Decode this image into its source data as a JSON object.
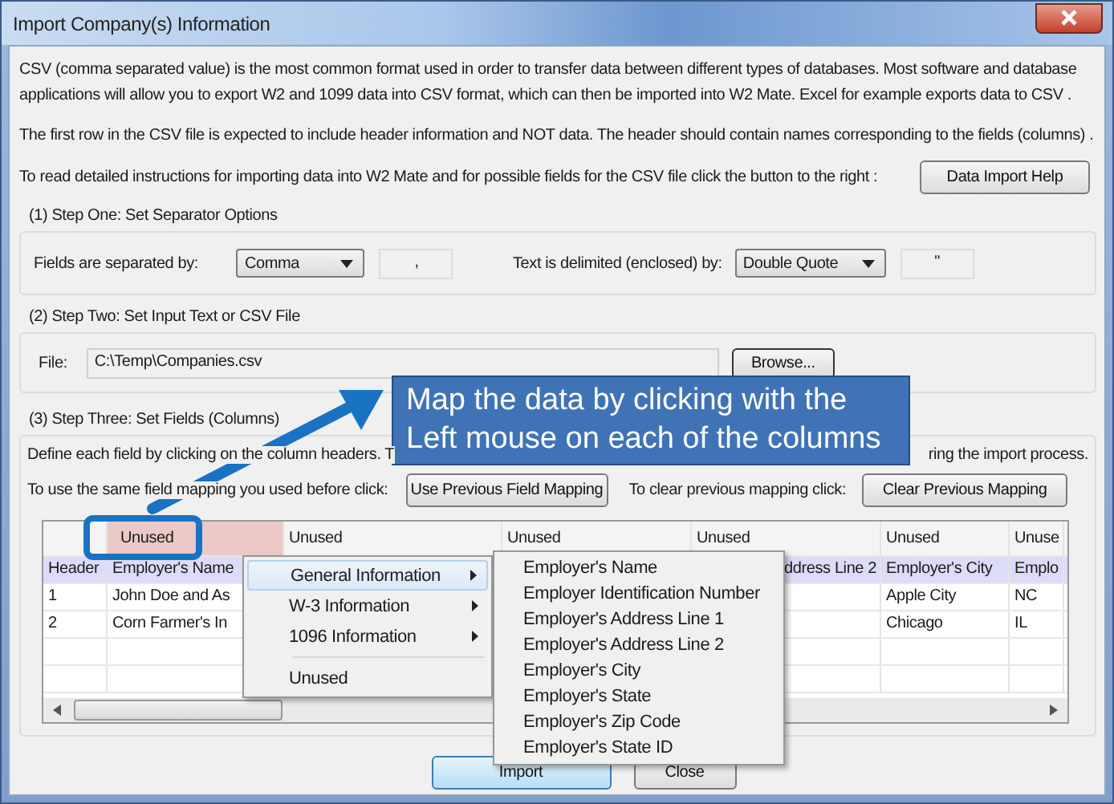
{
  "window": {
    "title": "Import Company(s) Information"
  },
  "intro": {
    "paragraphs": [
      "CSV (comma separated value) is the most common format used in order to transfer data between different types of databases.  Most software and database applications will allow you to export W2 and 1099 data into CSV format, which can then be imported into W2 Mate. Excel for example exports data to CSV .",
      "The first row in the CSV file is expected to include header information and NOT data. The header should contain names corresponding to the fields (columns) ."
    ],
    "help_text": "To read detailed instructions for importing data into W2 Mate and for possible fields for the CSV file click the button to the right :",
    "help_button": "Data Import Help"
  },
  "step_one": {
    "title": "(1)  Step One: Set Separator Options",
    "separator_label": "Fields are separated by:",
    "separator_value": "Comma",
    "separator_char": ",",
    "delimiter_label": "Text is delimited (enclosed) by:",
    "delimiter_value": "Double Quote",
    "delimiter_char": "\""
  },
  "step_two": {
    "title": "(2)  Step Two: Set Input Text or CSV File",
    "file_label": "File:",
    "file_value": "C:\\Temp\\Companies.csv",
    "browse_button": "Browse..."
  },
  "step_three": {
    "title": "(3)  Step Three: Set Fields (Columns)",
    "define_text_start": "Define each field by clicking on the column headers. T",
    "define_text_end": "ring the import process.",
    "previous_label": "To use the same field mapping you used before click:",
    "previous_button": "Use Previous Field Mapping",
    "clear_label": "To clear previous mapping click:",
    "clear_button": "Clear Previous Mapping",
    "table": {
      "columns": [
        {
          "selected": false
        },
        {
          "label": "Unused",
          "selected": true
        },
        {
          "label": "Unused",
          "selected": false
        },
        {
          "label": "Unused",
          "selected": false
        },
        {
          "label": "Unused",
          "selected": false
        },
        {
          "label": "Unused",
          "selected": false
        },
        {
          "label": "Unuse",
          "selected": false
        }
      ],
      "rows": [
        {
          "selected": true,
          "cells": [
            "Header",
            "Employer's Name",
            "",
            "",
            "ddress Line 2",
            "Employer's City",
            "Emplo"
          ]
        },
        {
          "selected": false,
          "cells": [
            "1",
            "John Doe and As",
            "",
            "",
            "",
            "Apple City",
            "NC"
          ]
        },
        {
          "selected": false,
          "cells": [
            "2",
            "Corn Farmer's In",
            "",
            "",
            "",
            "Chicago",
            "IL"
          ]
        },
        {
          "selected": false,
          "cells": [
            "",
            "",
            "",
            "",
            "",
            "",
            ""
          ]
        },
        {
          "selected": false,
          "cells": [
            "",
            "",
            "",
            "",
            "",
            "",
            ""
          ]
        }
      ]
    }
  },
  "context_menu": {
    "items": [
      {
        "label": "General  Information",
        "kind": "submenu",
        "selected": true
      },
      {
        "label": "W-3 Information",
        "kind": "submenu",
        "selected": false
      },
      {
        "label": "1096 Information",
        "kind": "submenu",
        "selected": false
      },
      {
        "label": "Unused",
        "kind": "item",
        "selected": false
      }
    ],
    "submenu": [
      "Employer's Name",
      "Employer Identification Number",
      "Employer's Address Line 1",
      "Employer's Address Line 2",
      "Employer's City",
      "Employer's State",
      "Employer's Zip Code",
      "Employer's State ID"
    ]
  },
  "callout": {
    "text": "Map the data by clicking with the Left mouse on each of the columns"
  },
  "buttons": [
    {
      "label": "Import",
      "default": true
    },
    {
      "label": "Close",
      "default": false
    }
  ]
}
